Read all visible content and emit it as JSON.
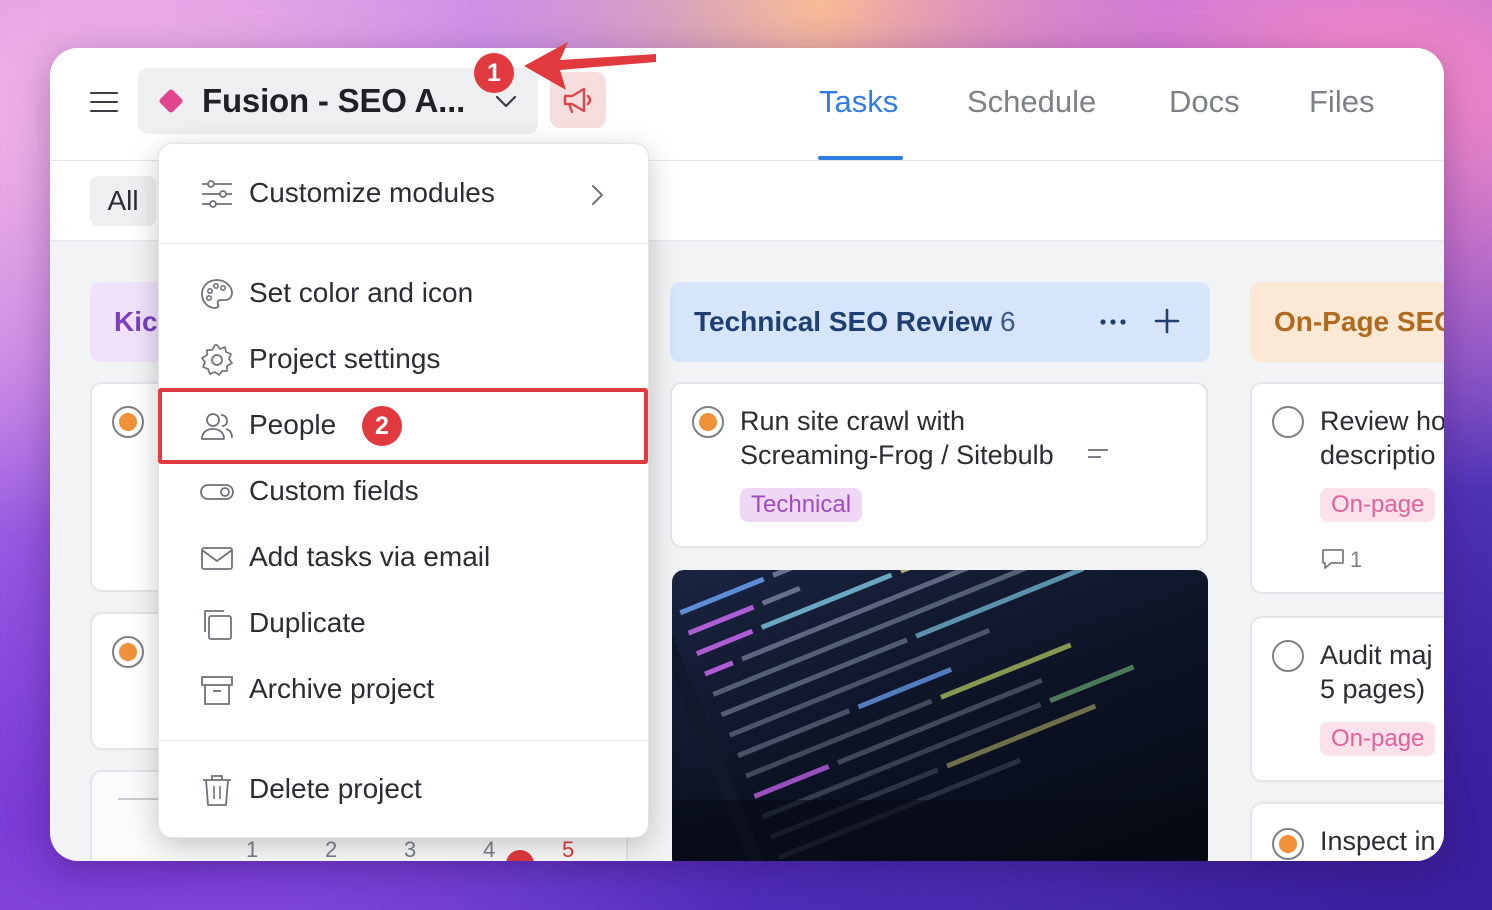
{
  "header": {
    "project_name": "Fusion - SEO A...",
    "tabs": [
      {
        "label": "Tasks",
        "active": true
      },
      {
        "label": "Schedule",
        "active": false
      },
      {
        "label": "Docs",
        "active": false
      },
      {
        "label": "Files",
        "active": false
      }
    ]
  },
  "filter": {
    "all_label": "All"
  },
  "columns": [
    {
      "title": "Kic",
      "color": "#f0e2fb"
    },
    {
      "title": "Technical SEO Review",
      "count": "6",
      "color": "#d6e5fa"
    },
    {
      "title": "On-Page SEO",
      "color": "#fbe9d6"
    }
  ],
  "cards": {
    "tech_card1": {
      "line1": "Run site crawl with",
      "line2": "Screaming-Frog / Sitebulb",
      "tag": "Technical"
    },
    "onpage_card1": {
      "line1": "Review ho",
      "line2": "descriptio",
      "tag": "On-page",
      "comments": "1"
    },
    "onpage_card2": {
      "line1": "Audit maj",
      "line2": "5 pages)",
      "tag": "On-page"
    },
    "onpage_card3": {
      "line1": "Inspect in"
    },
    "kickoff_calendar": [
      "1",
      "2",
      "3",
      "4",
      "5"
    ]
  },
  "menu": {
    "items": [
      {
        "label": "Customize modules",
        "icon": "sliders-icon",
        "has_submenu": true
      },
      {
        "label": "Set color and icon",
        "icon": "palette-icon"
      },
      {
        "label": "Project settings",
        "icon": "gear-icon"
      },
      {
        "label": "People",
        "icon": "people-icon"
      },
      {
        "label": "Custom fields",
        "icon": "toggle-icon"
      },
      {
        "label": "Add tasks via email",
        "icon": "envelope-icon"
      },
      {
        "label": "Duplicate",
        "icon": "duplicate-icon"
      },
      {
        "label": "Archive project",
        "icon": "archive-icon"
      },
      {
        "label": "Delete project",
        "icon": "trash-icon"
      }
    ]
  },
  "annotations": {
    "step1": "1",
    "step2": "2"
  },
  "colors": {
    "accent": "#2f7de1",
    "annotation_red": "#e0393e",
    "project_pink": "#e0458d",
    "status_orange": "#f0913a"
  }
}
